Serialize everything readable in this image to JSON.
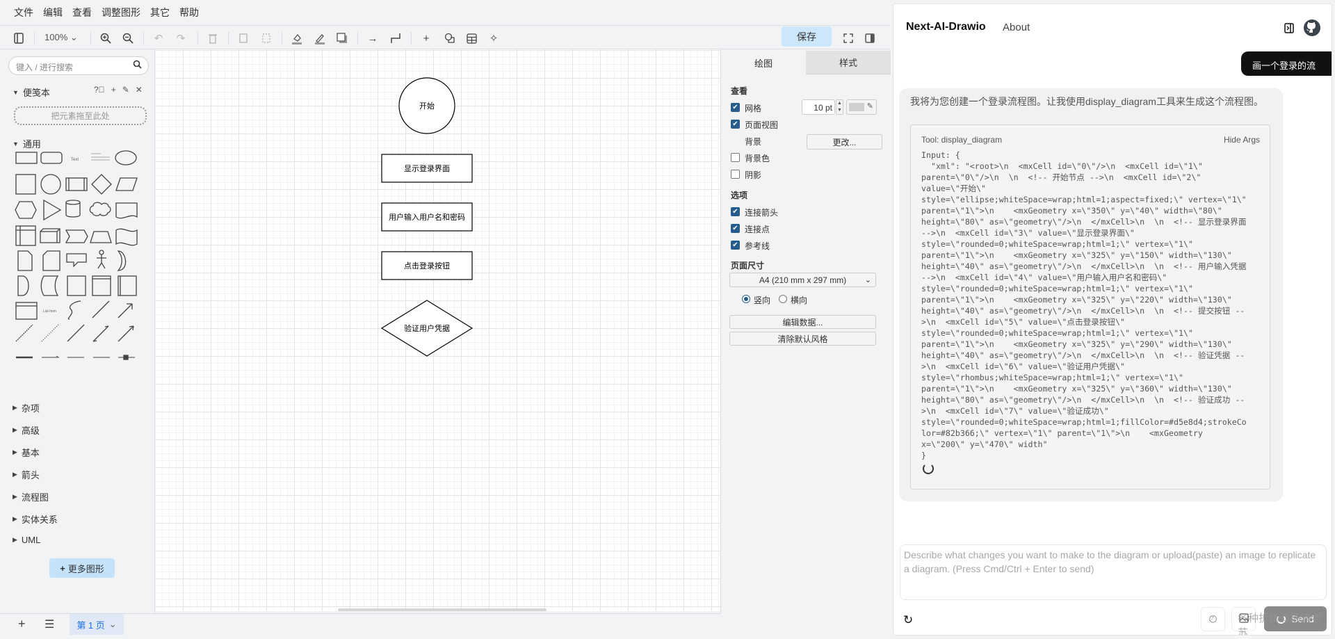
{
  "menu": [
    "文件",
    "编辑",
    "查看",
    "调整图形",
    "其它",
    "帮助"
  ],
  "toolbar": {
    "zoom": "100%",
    "save": "保存"
  },
  "sidebar": {
    "search_placeholder": "键入 / 进行搜索",
    "scratchpad": "便笺本",
    "drop_hint": "把元素拖至此处",
    "general": "通用",
    "sections": [
      "杂项",
      "高级",
      "基本",
      "箭头",
      "流程图",
      "实体关系",
      "UML"
    ],
    "more_shapes": "更多图形"
  },
  "diagram": {
    "nodes": [
      {
        "label": "开始",
        "shape": "ellipse"
      },
      {
        "label": "显示登录界面",
        "shape": "rect"
      },
      {
        "label": "用户输入用户名和密码",
        "shape": "rect"
      },
      {
        "label": "点击登录按钮",
        "shape": "rect"
      },
      {
        "label": "验证用户凭据",
        "shape": "rhombus"
      }
    ]
  },
  "bottom": {
    "page_tab": "第 1 页"
  },
  "format": {
    "tabs": [
      "绘图",
      "样式"
    ],
    "view_heading": "查看",
    "grid": {
      "label": "网格",
      "checked": true,
      "size": "10 pt",
      "color": "#d0d0d0"
    },
    "page_view": {
      "label": "页面视图",
      "checked": true
    },
    "background": {
      "label": "背景",
      "button": "更改..."
    },
    "background_color": {
      "label": "背景色",
      "checked": false
    },
    "shadow": {
      "label": "阴影",
      "checked": false
    },
    "options_heading": "选项",
    "connection_arrows": {
      "label": "连接箭头",
      "checked": true
    },
    "connection_points": {
      "label": "连接点",
      "checked": true
    },
    "guides": {
      "label": "参考线",
      "checked": true
    },
    "page_size_heading": "页面尺寸",
    "page_size": "A4 (210 mm x 297 mm)",
    "portrait": "竖向",
    "landscape": "横向",
    "orientation": "portrait",
    "edit_data": "编辑数据...",
    "clear_style": "清除默认风格"
  },
  "chat": {
    "brand": "Next-AI-Drawio",
    "about": "About",
    "user_message": "画一个登录的流",
    "assistant_message": "我将为您创建一个登录流程图。让我使用display_diagram工具来生成这个流程图。",
    "tool_title": "Tool: display_diagram",
    "hide_args": "Hide Args",
    "input_lines": [
      "Input: {",
      "  \"xml\": \"<root>\\n  <mxCell id=\\\"0\\\"/>\\n  <mxCell id=\\\"1\\\"",
      "parent=\\\"0\\\"/>\\n  \\n  <!-- 开始节点 -->\\n  <mxCell id=\\\"2\\\"",
      "value=\\\"开始\\\"",
      "style=\\\"ellipse;whiteSpace=wrap;html=1;aspect=fixed;\\\" vertex=\\\"1\\\"",
      "parent=\\\"1\\\">\\n    <mxGeometry x=\\\"350\\\" y=\\\"40\\\" width=\\\"80\\\"",
      "height=\\\"80\\\" as=\\\"geometry\\\"/>\\n  </mxCell>\\n  \\n  <!-- 显示登录界面",
      "-->\\n  <mxCell id=\\\"3\\\" value=\\\"显示登录界面\\\"",
      "style=\\\"rounded=0;whiteSpace=wrap;html=1;\\\" vertex=\\\"1\\\"",
      "parent=\\\"1\\\">\\n    <mxGeometry x=\\\"325\\\" y=\\\"150\\\" width=\\\"130\\\"",
      "height=\\\"40\\\" as=\\\"geometry\\\"/>\\n  </mxCell>\\n  \\n  <!-- 用户输入凭据",
      "-->\\n  <mxCell id=\\\"4\\\" value=\\\"用户输入用户名和密码\\\"",
      "style=\\\"rounded=0;whiteSpace=wrap;html=1;\\\" vertex=\\\"1\\\"",
      "parent=\\\"1\\\">\\n    <mxGeometry x=\\\"325\\\" y=\\\"220\\\" width=\\\"130\\\"",
      "height=\\\"40\\\" as=\\\"geometry\\\"/>\\n  </mxCell>\\n  \\n  <!-- 提交按钮 --",
      ">\\n  <mxCell id=\\\"5\\\" value=\\\"点击登录按钮\\\"",
      "style=\\\"rounded=0;whiteSpace=wrap;html=1;\\\" vertex=\\\"1\\\"",
      "parent=\\\"1\\\">\\n    <mxGeometry x=\\\"325\\\" y=\\\"290\\\" width=\\\"130\\\"",
      "height=\\\"40\\\" as=\\\"geometry\\\"/>\\n  </mxCell>\\n  \\n  <!-- 验证凭据 --",
      ">\\n  <mxCell id=\\\"6\\\" value=\\\"验证用户凭据\\\"",
      "style=\\\"rhombus;whiteSpace=wrap;html=1;\\\" vertex=\\\"1\\\"",
      "parent=\\\"1\\\">\\n    <mxGeometry x=\\\"325\\\" y=\\\"360\\\" width=\\\"130\\\"",
      "height=\\\"80\\\" as=\\\"geometry\\\"/>\\n  </mxCell>\\n  \\n  <!-- 验证成功 --",
      ">\\n  <mxCell id=\\\"7\\\" value=\\\"验证成功\\\"",
      "style=\\\"rounded=0;whiteSpace=wrap;html=1;fillColor=#d5e8d4;strokeCo",
      "lor=#82b366;\\\" vertex=\\\"1\\\" parent=\\\"1\\\">\\n    <mxGeometry",
      "x=\\\"200\\\" y=\\\"470\\\" width\"",
      "}"
    ],
    "input_placeholder": "Describe what changes you want to make to the diagram or upload(paste) an image to replicate a diagram. (Press Cmd/Ctrl + Enter to send)",
    "send": "Send",
    "watermark": "各种折腾@杨浦老苏"
  }
}
